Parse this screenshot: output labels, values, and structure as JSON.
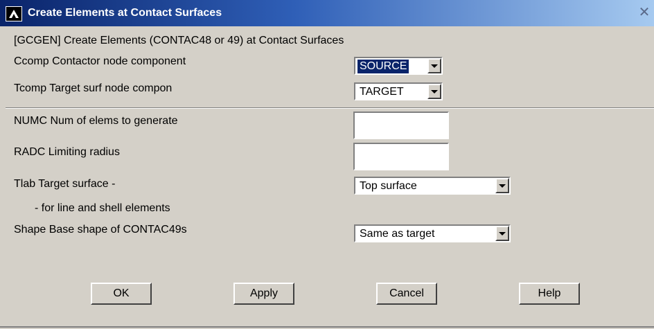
{
  "window": {
    "title": "Create Elements at Contact Surfaces",
    "close_symbol": "✕"
  },
  "command": "[GCGEN]  Create Elements (CONTAC48 or 49) at Contact Surfaces",
  "fields": {
    "ccomp": {
      "label": "Ccomp  Contactor node component",
      "value": "SOURCE"
    },
    "tcomp": {
      "label": "Tcomp  Target surf node compon",
      "value": "TARGET"
    },
    "numc": {
      "label": "NUMC   Num of elems to generate",
      "value": ""
    },
    "radc": {
      "label": "RADC   Limiting radius",
      "value": ""
    },
    "tlab": {
      "label": "Tlab   Target surface -",
      "sublabel": "- for line and shell elements",
      "value": "Top surface"
    },
    "shape": {
      "label": "Shape  Base shape of CONTAC49s",
      "value": "Same as target"
    }
  },
  "buttons": {
    "ok": "OK",
    "apply": "Apply",
    "cancel": "Cancel",
    "help": "Help"
  },
  "icons": {
    "app_logo": "ansys-logo-icon",
    "close": "close-icon",
    "dropdown": "chevron-down-icon"
  }
}
